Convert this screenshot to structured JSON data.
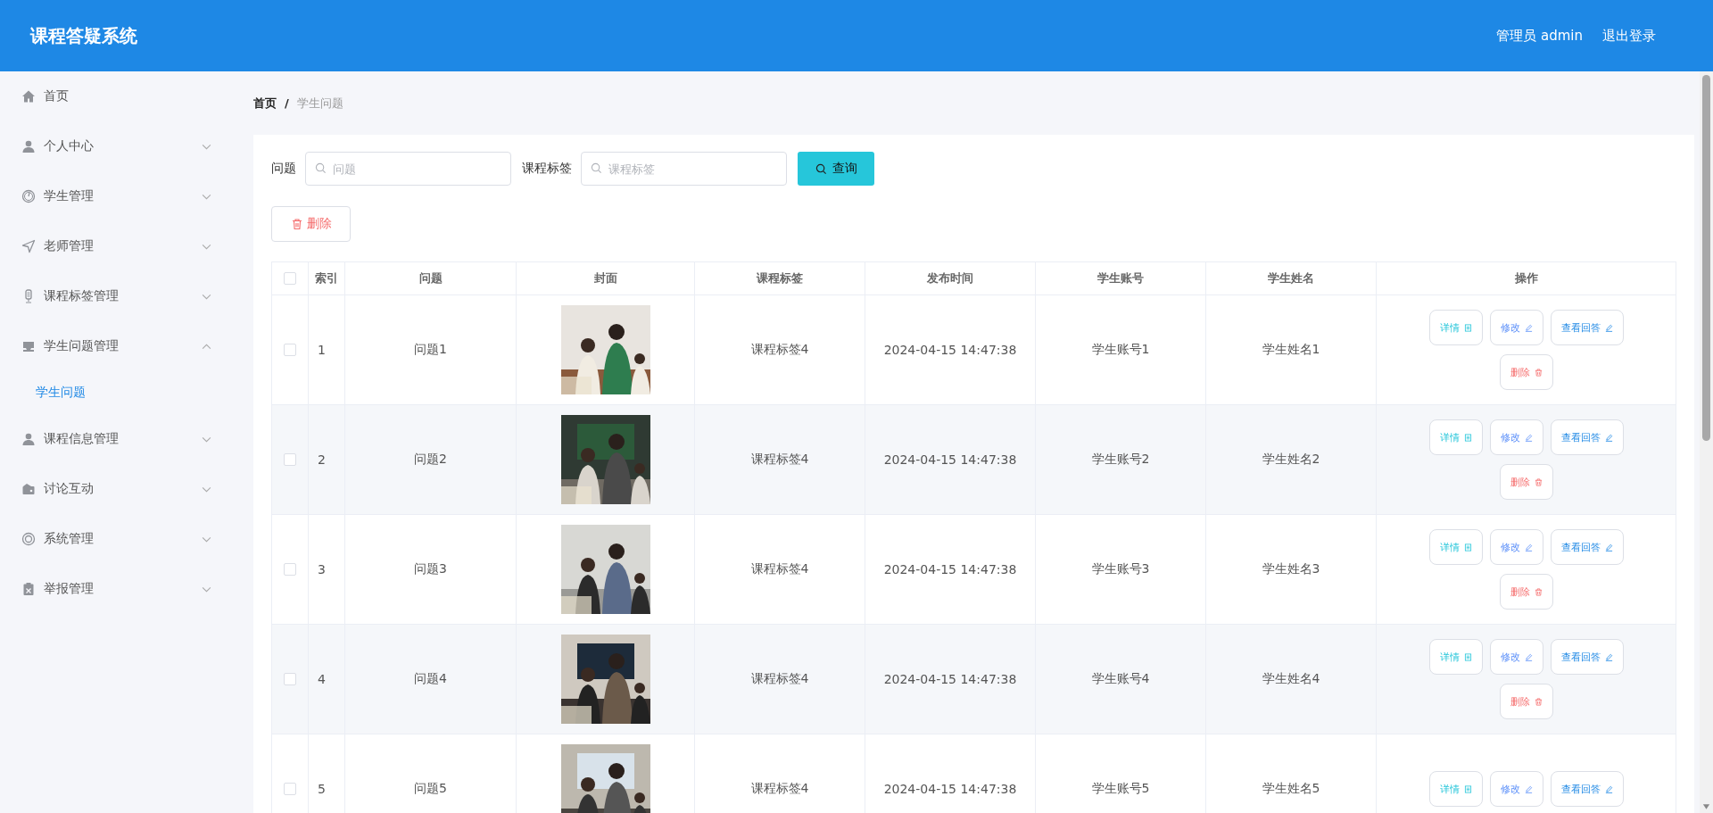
{
  "header": {
    "title": "课程答疑系统",
    "user": "管理员 admin",
    "logout": "退出登录"
  },
  "sidebar": {
    "items": [
      {
        "label": "首页",
        "kind": "link"
      },
      {
        "label": "个人中心",
        "kind": "group",
        "expanded": false
      },
      {
        "label": "学生管理",
        "kind": "group",
        "expanded": false
      },
      {
        "label": "老师管理",
        "kind": "group",
        "expanded": false
      },
      {
        "label": "课程标签管理",
        "kind": "group",
        "expanded": false
      },
      {
        "label": "学生问题管理",
        "kind": "group",
        "expanded": true,
        "children": [
          {
            "label": "学生问题",
            "selected": true
          }
        ]
      },
      {
        "label": "课程信息管理",
        "kind": "group",
        "expanded": false
      },
      {
        "label": "讨论互动",
        "kind": "group",
        "expanded": false
      },
      {
        "label": "系统管理",
        "kind": "group",
        "expanded": false
      },
      {
        "label": "举报管理",
        "kind": "group",
        "expanded": false
      }
    ]
  },
  "breadcrumb": {
    "items": [
      "首页",
      "学生问题"
    ],
    "separator": "/"
  },
  "search": {
    "fields": [
      {
        "label": "问题",
        "placeholder": "问题"
      },
      {
        "label": "课程标签",
        "placeholder": "课程标签"
      }
    ],
    "button": "查询"
  },
  "delete_button": "删除",
  "table": {
    "columns": [
      "索引",
      "问题",
      "封面",
      "课程标签",
      "发布时间",
      "学生账号",
      "学生姓名",
      "操作"
    ],
    "header_checked": false,
    "rows": [
      {
        "checked": false,
        "index": "1",
        "question": "问题1",
        "cover": {
          "kind": "picture"
        },
        "tag": "课程标签4",
        "time": "2024-04-15 14:47:38",
        "account": "学生账号1",
        "name": "学生姓名1",
        "actions": [
          {
            "kind": "detail",
            "label": "详情"
          },
          {
            "kind": "edit",
            "label": "修改"
          },
          {
            "kind": "answer",
            "label": "查看回答"
          },
          {
            "kind": "delete",
            "label": "删除"
          }
        ]
      },
      {
        "checked": false,
        "index": "2",
        "question": "问题2",
        "cover": {
          "kind": "picture"
        },
        "tag": "课程标签4",
        "time": "2024-04-15 14:47:38",
        "account": "学生账号2",
        "name": "学生姓名2",
        "actions": [
          {
            "kind": "detail",
            "label": "详情"
          },
          {
            "kind": "edit",
            "label": "修改"
          },
          {
            "kind": "answer",
            "label": "查看回答"
          },
          {
            "kind": "delete",
            "label": "删除"
          }
        ]
      },
      {
        "checked": false,
        "index": "3",
        "question": "问题3",
        "cover": {
          "kind": "picture"
        },
        "tag": "课程标签4",
        "time": "2024-04-15 14:47:38",
        "account": "学生账号3",
        "name": "学生姓名3",
        "actions": [
          {
            "kind": "detail",
            "label": "详情"
          },
          {
            "kind": "edit",
            "label": "修改"
          },
          {
            "kind": "answer",
            "label": "查看回答"
          },
          {
            "kind": "delete",
            "label": "删除"
          }
        ]
      },
      {
        "checked": false,
        "index": "4",
        "question": "问题4",
        "cover": {
          "kind": "picture"
        },
        "tag": "课程标签4",
        "time": "2024-04-15 14:47:38",
        "account": "学生账号4",
        "name": "学生姓名4",
        "actions": [
          {
            "kind": "detail",
            "label": "详情"
          },
          {
            "kind": "edit",
            "label": "修改"
          },
          {
            "kind": "answer",
            "label": "查看回答"
          },
          {
            "kind": "delete",
            "label": "删除"
          }
        ]
      },
      {
        "checked": false,
        "index": "5",
        "question": "问题5",
        "cover": {
          "kind": "picture"
        },
        "tag": "课程标签4",
        "time": "2024-04-15 14:47:38",
        "account": "学生账号5",
        "name": "学生姓名5",
        "actions": [
          {
            "kind": "detail",
            "label": "详情"
          },
          {
            "kind": "edit",
            "label": "修改"
          },
          {
            "kind": "answer",
            "label": "查看回答"
          }
        ]
      }
    ]
  }
}
